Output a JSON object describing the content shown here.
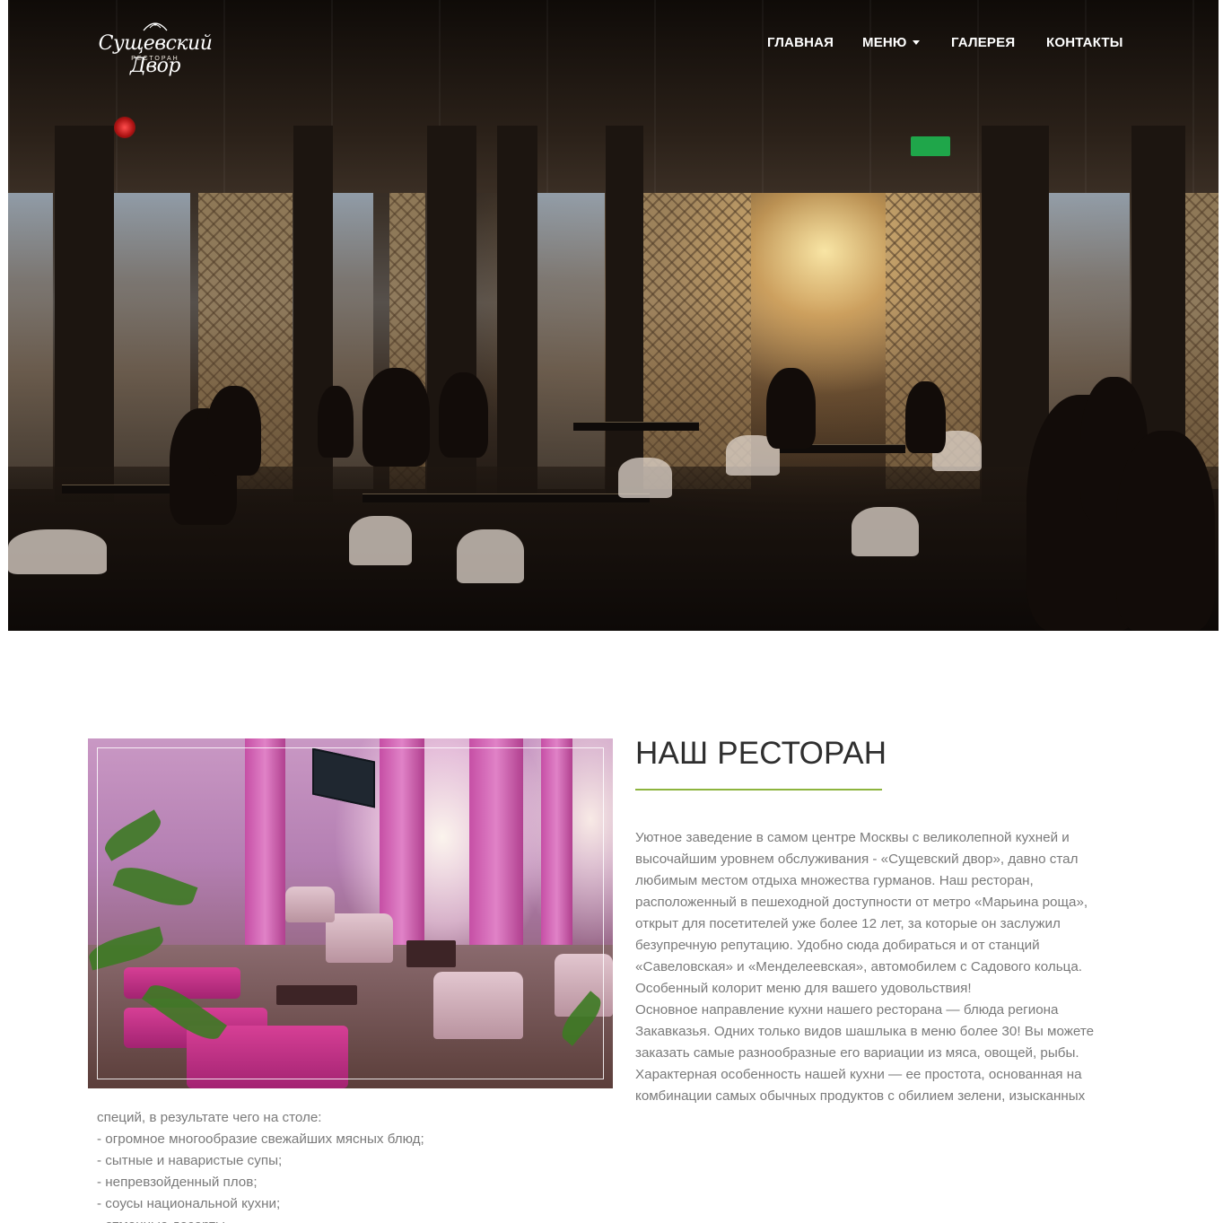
{
  "header": {
    "logo": {
      "name": "Сущевский Двор",
      "subtitle": "РЕСТОРАН"
    },
    "nav": [
      {
        "label": "ГЛАВНАЯ"
      },
      {
        "label": "МЕНЮ",
        "has_dropdown": true
      },
      {
        "label": "ГАЛЕРЕЯ"
      },
      {
        "label": "КОНТАКТЫ"
      }
    ]
  },
  "about": {
    "title": "НАШ РЕСТОРАН",
    "accent_color": "#8db43e",
    "paragraph_lines": [
      "Уютное заведение в самом центре Москвы с великолепной кухней и",
      "высочайшим уровнем обслуживания - «Сущевский двор», давно стал",
      "любимым местом отдыха множества гурманов. Наш ресторан,",
      "расположенный в пешеходной доступности от метро «Марьина роща»,",
      "открыт для посетителей уже более 12 лет, за которые он заслужил",
      "безупречную репутацию. Удобно сюда добираться и от станций",
      "«Савеловская» и «Менделеевская», автомобилем с Садового кольца.",
      "Особенный колорит меню для вашего удовольствия!",
      "Основное направление кухни нашего ресторана — блюда региона",
      "Закавказья. Одних только видов шашлыка в меню более 30! Вы можете",
      "заказать самые разнообразные его вариации из мяса, овощей, рыбы.",
      "Характерная особенность нашей кухни — ее простота, основанная на",
      "комбинации самых обычных продуктов с обилием зелени, изысканных"
    ],
    "continuation_lines": [
      "специй, в результате чего на столе:",
      "- огромное многообразие свежайших мясных блюд;",
      "- сытные и наваристые супы;",
      "- непревзойденный плов;",
      "- соусы национальной кухни;",
      "- отменные десерты."
    ]
  }
}
